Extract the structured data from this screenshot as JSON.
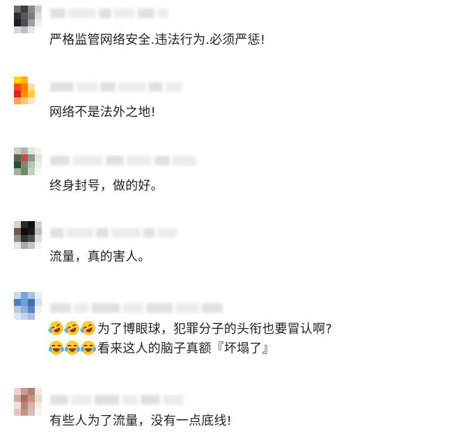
{
  "comments": [
    {
      "avatar": [
        "#6b6b6b",
        "#3d3d3d",
        "#8a8a8a",
        "#cfcfcf",
        "#2f2f2f",
        "#555a60",
        "#7d7d7d",
        "#e0e0e0",
        "#1f1f1f",
        "#4a4f55",
        "#9aa0a5",
        "#f0f0f0",
        "#d7d7d7",
        "#bfbfbf",
        "#e8e8e8",
        "#ffffff"
      ],
      "text": "严格监管网络安全.违法行为.必须严惩!"
    },
    {
      "avatar": [
        "#ffd400",
        "#ffb300",
        "#ffffff",
        "#ffffff",
        "#ff4a1c",
        "#ff7a00",
        "#ffe38a",
        "#ffffff",
        "#e81d1d",
        "#ff8c00",
        "#ffcf3a",
        "#ffffff",
        "#ffa34d",
        "#ffc27a",
        "#ffe7b8",
        "#ffffff"
      ],
      "text": "网络不是法外之地!"
    },
    {
      "avatar": [
        "#c9cfc5",
        "#aeb7a8",
        "#e3e6df",
        "#f3f3f3",
        "#4e6b55",
        "#c24a4a",
        "#8c9c8a",
        "#dfe3dc",
        "#2f4d3a",
        "#7c8b74",
        "#b8c2b0",
        "#eceeea",
        "#9fb29a",
        "#6f8a6a",
        "#c7d1c2",
        "#f6f6f6"
      ],
      "text": "终身封号，做的好。"
    },
    {
      "avatar": [
        "#d8d4d0",
        "#2a2a2a",
        "#111111",
        "#cfcfcf",
        "#6b5d55",
        "#0d0d0d",
        "#1c1c1c",
        "#bdbdbd",
        "#8c8c8c",
        "#333333",
        "#4d4d4d",
        "#dcdcdc",
        "#e6e6e6",
        "#a8a8a8",
        "#c4c4c4",
        "#f5f5f5"
      ],
      "text": "流量，真的害人。"
    },
    {
      "avatar": [
        "#c9d9ee",
        "#7fa4d3",
        "#a9c3e4",
        "#e6eef8",
        "#4d7ec0",
        "#6f9fd8",
        "#3f6fb2",
        "#d3e1f3",
        "#b7cbe6",
        "#8fb2dd",
        "#5a86c4",
        "#eef3fa",
        "#dde6f2",
        "#c5d4ea",
        "#aebfe0",
        "#ffffff"
      ],
      "line1": "为了博眼球，犯罪分子的头衔也要冒认啊?",
      "line2": "看来这人的脑子真额『坏塌了』"
    },
    {
      "avatar": [
        "#e7d3cf",
        "#c99a8f",
        "#b07d72",
        "#f1e3df",
        "#d2aa9f",
        "#a66e62",
        "#c98f83",
        "#ead6d1",
        "#f0dfdb",
        "#b88478",
        "#d7b1a8",
        "#f6ebe8",
        "#e3c6bf",
        "#c49287",
        "#dbbbb3",
        "#fbf4f2"
      ],
      "text": "有些人为了流量，没有一点底线!"
    }
  ]
}
